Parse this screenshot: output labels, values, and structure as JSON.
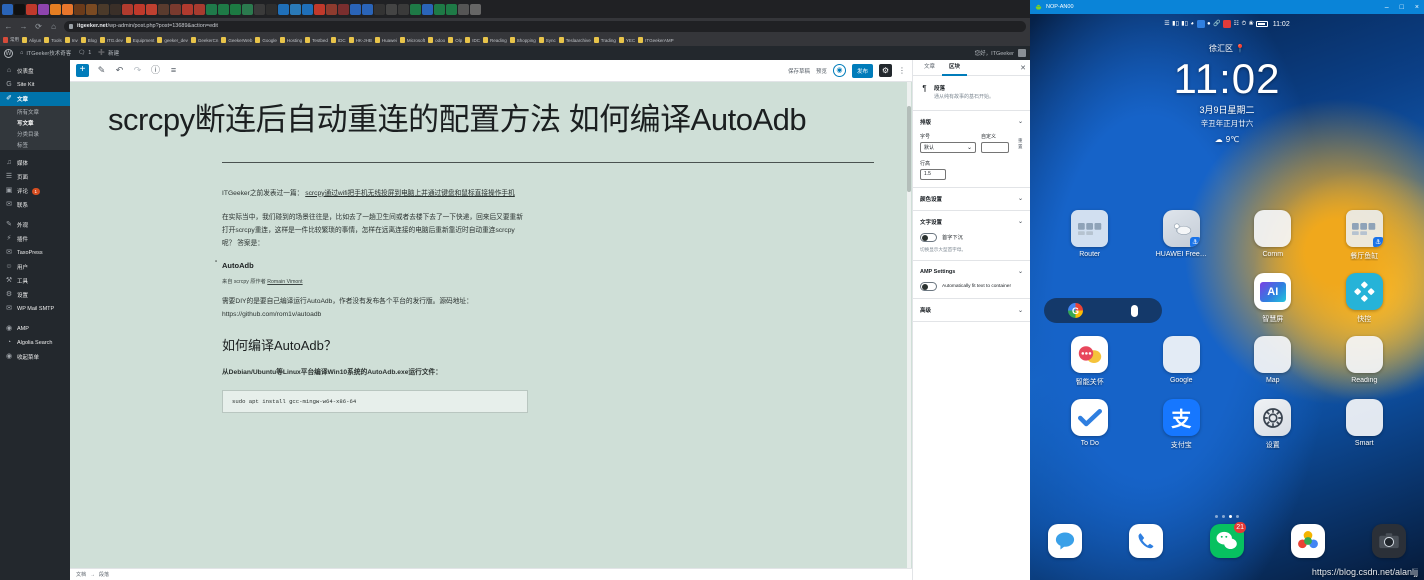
{
  "browser": {
    "url_host": "itgeeker.net",
    "url_path": "/wp-admin/post.php?post=13689&action=edit",
    "nav_icons": [
      "back-icon",
      "forward-icon",
      "reload-icon",
      "home-icon"
    ],
    "bookmarks": [
      {
        "label": "常用",
        "color": "red"
      },
      {
        "label": "Aliyun",
        "color": "yellow"
      },
      {
        "label": "Tools",
        "color": "yellow"
      },
      {
        "label": "Inv",
        "color": "yellow"
      },
      {
        "label": "Blog",
        "color": "yellow"
      },
      {
        "label": "ITG.dev",
        "color": "yellow"
      },
      {
        "label": "Equipment",
        "color": "yellow"
      },
      {
        "label": "geeker_dev",
        "color": "yellow"
      },
      {
        "label": "GeekerCn",
        "color": "yellow"
      },
      {
        "label": "GeekerWeb",
        "color": "yellow"
      },
      {
        "label": "Google",
        "color": "yellow"
      },
      {
        "label": "Hosting",
        "color": "yellow"
      },
      {
        "label": "Testbed",
        "color": "yellow"
      },
      {
        "label": "IDC",
        "color": "yellow"
      },
      {
        "label": "HK-JHB",
        "color": "yellow"
      },
      {
        "label": "Huawei",
        "color": "yellow"
      },
      {
        "label": "Microsoft",
        "color": "yellow"
      },
      {
        "label": "odoo",
        "color": "yellow"
      },
      {
        "label": "Olp",
        "color": "yellow"
      },
      {
        "label": "IDC",
        "color": "yellow"
      },
      {
        "label": "Reading",
        "color": "yellow"
      },
      {
        "label": "Shopping",
        "color": "yellow"
      },
      {
        "label": "Sync",
        "color": "yellow"
      },
      {
        "label": "Teslaarchive",
        "color": "yellow"
      },
      {
        "label": "Trading",
        "color": "yellow"
      },
      {
        "label": "YEC",
        "color": "yellow"
      },
      {
        "label": "ITGeekerAMP",
        "color": "yellow"
      }
    ]
  },
  "admin_bar": {
    "logo": "wordpress-icon",
    "site_name": "ITGeeker技术奇客",
    "comments_count": "1",
    "new_label": "新建",
    "howdy": "您好，ITGeeker"
  },
  "sidebar": {
    "items": [
      {
        "label": "仪表盘",
        "icon": "dashboard-icon",
        "active": false
      },
      {
        "label": "Site Kit",
        "icon": "google-icon",
        "active": false
      },
      {
        "label": "文章",
        "icon": "pin-icon",
        "active": true
      }
    ],
    "subitems": [
      {
        "label": "所有文章",
        "current": false
      },
      {
        "label": "写文章",
        "current": true
      },
      {
        "label": "分类目录",
        "current": false
      },
      {
        "label": "标签",
        "current": false
      }
    ],
    "items2": [
      {
        "label": "媒体",
        "icon": "media-icon",
        "badge": ""
      },
      {
        "label": "页面",
        "icon": "page-icon",
        "badge": ""
      },
      {
        "label": "评论",
        "icon": "comment-icon",
        "badge": "1"
      },
      {
        "label": "联系",
        "icon": "mail-icon",
        "badge": ""
      }
    ],
    "items3": [
      {
        "label": "外观",
        "icon": "brush-icon"
      },
      {
        "label": "插件",
        "icon": "plugin-icon"
      },
      {
        "label": "TaxoPress",
        "icon": "tag-icon"
      },
      {
        "label": "用户",
        "icon": "user-icon"
      },
      {
        "label": "工具",
        "icon": "tools-icon"
      },
      {
        "label": "设置",
        "icon": "settings-icon"
      },
      {
        "label": "WP Mail SMTP",
        "icon": "envelope-icon"
      }
    ],
    "items4": [
      {
        "label": "AMP",
        "icon": "amp-icon"
      },
      {
        "label": "Algolia Search",
        "icon": "search-icon"
      },
      {
        "label": "收起菜单",
        "icon": "collapse-icon"
      }
    ]
  },
  "editor_toolbar": {
    "add_block": "+",
    "edit_icon": "pencil-icon",
    "undo_icon": "undo-icon",
    "redo_icon": "redo-icon",
    "info_icon": "info-icon",
    "list_view_icon": "list-view-icon",
    "save_draft": "保存草稿",
    "preview": "预览",
    "publish": "发布",
    "settings_icon": "gear-icon",
    "more_icon": "kebab-menu-icon"
  },
  "document": {
    "title": "scrcpy断连后自动重连的配置方法 如何编译AutoAdb",
    "para1_lead": "ITGeeker之前发表过一篇： ",
    "para1_link": "scrcpy通过wifi把手机无线投屏到电脑上并通过键盘和鼠标直接操作手机",
    "para2": "在实际当中，我们碰到的场景往往是，比如去了一趟卫生间或者去楼下去了一下快递，回来后又要重新打开scrcpy重连，这样是一件比较繁琐的事情，怎样在远离连接的电脑后重新靠近时自动重连scrcpy呢？ 答案是：",
    "heading_autoadb": "AutoAdb",
    "credit_prefix": "来自 scrcpy 原作者 ",
    "credit_author": "Romain Vimont",
    "para3_a": "需要DIY的是要自己编译运行AutoAdb，作者没有发布各个平台的发行版。源码地址： ",
    "para3_url": "https://github.com/rom1v/autoadb",
    "heading_how": "如何编译AutoAdb？",
    "para4": "从Debian/Ubuntu等Linux平台编译Win10系统的AutoAdb.exe运行文件：",
    "code": "sudo apt install gcc-mingw-w64-x86-64"
  },
  "status_bar": {
    "breadcrumb_doc": "文档",
    "breadcrumb_sep": "→",
    "breadcrumb_block": "段落"
  },
  "settings_panel": {
    "tabs": [
      {
        "label": "文章",
        "active": false
      },
      {
        "label": "区块",
        "active": true
      }
    ],
    "close_icon": "close-icon",
    "block_icon": "paragraph-icon",
    "block_name": "段落",
    "block_desc": "通从纯有故事的基石开始。",
    "typography": {
      "title": "排版",
      "font_size_label": "字号",
      "font_size_value": "默认",
      "custom_label": "自定义",
      "custom_value": "",
      "reset_label": "重置",
      "line_height_label": "行高",
      "line_height_value": "1.5"
    },
    "color_settings": {
      "title": "颜色设置"
    },
    "text_settings": {
      "title": "文字设置",
      "toggle_label": "首字下沉",
      "help": "切换显示大型首字母。"
    },
    "amp_settings": {
      "title": "AMP Settings",
      "toggle_label": "Automatically fit text to container"
    },
    "advanced": {
      "title": "高级"
    }
  },
  "phone": {
    "window_title": "NOP-AN00",
    "window_controls": {
      "minimize": "–",
      "maximize": "□",
      "close": "×"
    },
    "status": {
      "time": "11:02",
      "icons": [
        "dual-sim-icon",
        "signal-icon",
        "signal-icon",
        "wifi-icon",
        "vpn-icon",
        "dot-icon",
        "link-icon",
        "stop-icon",
        "nfc-icon",
        "alarm-icon",
        "bluetooth-icon",
        "battery-icon"
      ]
    },
    "widget": {
      "location": "徐汇区",
      "location_icon": "location-pin-icon",
      "clock": "11:02",
      "date": "3月9日星期二",
      "lunar": "辛丑年正月廿六",
      "weather_icon": "cloud-icon",
      "temperature": "9℃"
    },
    "search": {
      "google_icon": "google-g-icon",
      "mic_icon": "microphone-icon"
    },
    "apps": [
      {
        "label": "Router",
        "type": "widget-tile",
        "badge": ""
      },
      {
        "label": "HUAWEI Free…",
        "type": "image-tile",
        "badge": "link-badge"
      },
      {
        "label": "Comm",
        "type": "folder",
        "badge": ""
      },
      {
        "label": "餐厅鱼缸",
        "type": "widget-tile",
        "badge": "link-badge"
      },
      {
        "label": "",
        "type": "empty",
        "badge": ""
      },
      {
        "label": "",
        "type": "empty",
        "badge": ""
      },
      {
        "label": "智慧屏",
        "type": "ai-tile",
        "badge": ""
      },
      {
        "label": "快控",
        "type": "diamond-tile",
        "badge": ""
      },
      {
        "label": "智能关怀",
        "type": "care-tile",
        "badge": ""
      },
      {
        "label": "Google",
        "type": "folder",
        "badge": ""
      },
      {
        "label": "Map",
        "type": "folder",
        "badge": ""
      },
      {
        "label": "Reading",
        "type": "folder",
        "badge": ""
      },
      {
        "label": "To Do",
        "type": "todo-tile",
        "badge": ""
      },
      {
        "label": "支付宝",
        "type": "alipay-tile",
        "badge": ""
      },
      {
        "label": "设置",
        "type": "settings-tile",
        "badge": ""
      },
      {
        "label": "Smart",
        "type": "folder",
        "badge": ""
      }
    ],
    "dock": [
      {
        "name": "messages-icon",
        "badge": ""
      },
      {
        "name": "phone-icon",
        "badge": ""
      },
      {
        "name": "wechat-icon",
        "badge": "21"
      },
      {
        "name": "gallery-icon",
        "badge": ""
      },
      {
        "name": "camera-icon",
        "badge": ""
      }
    ],
    "page_dots": 4,
    "page_active": 2,
    "watermark": "https://blog.csdn.net/alanljj"
  }
}
